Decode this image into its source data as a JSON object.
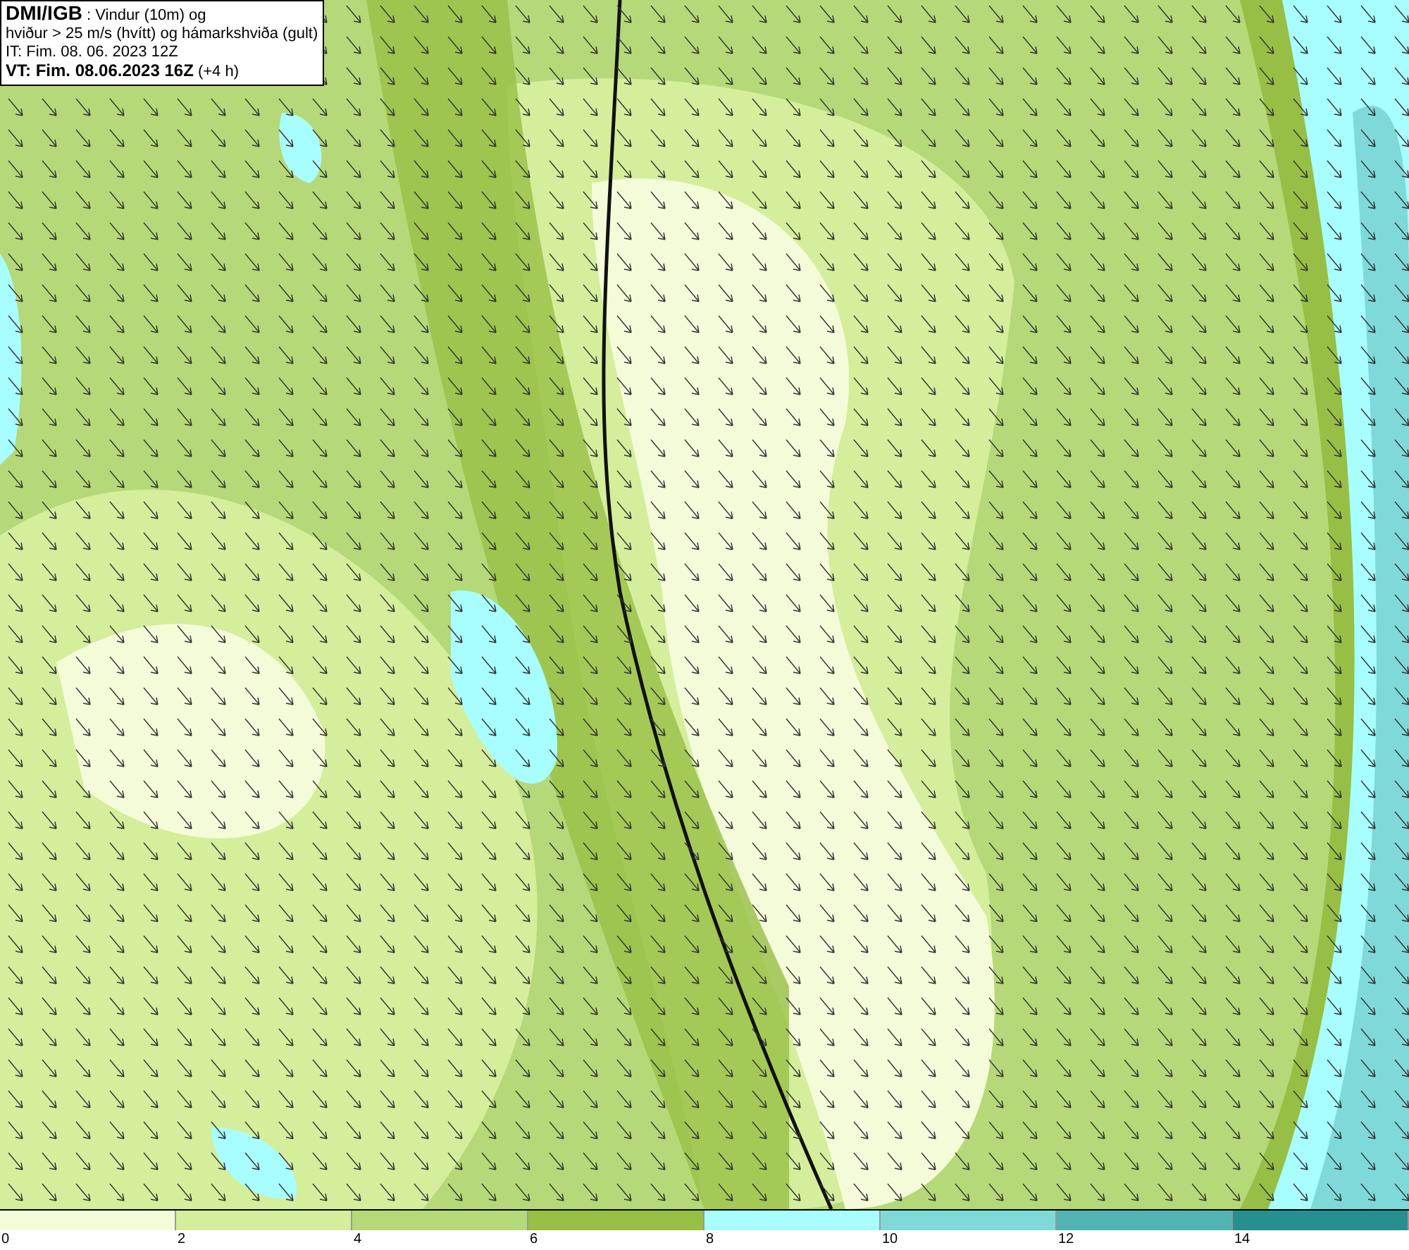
{
  "header": {
    "lines": [
      "**DMI/IGB** : Vindur (10m) og",
      "hviður > 25 m/s (hvítt) og hámarkshviða (gult)",
      "IT: Fim. 08. 06. 2023 12Z",
      "**VT: Fim. 08.06.2023 16Z** (+4 h)"
    ]
  },
  "legend": {
    "bins": [
      {
        "label": "0",
        "color": "#f4fbd9"
      },
      {
        "label": "2",
        "color": "#d4ee9c"
      },
      {
        "label": "4",
        "color": "#b5d978"
      },
      {
        "label": "6",
        "color": "#97bf46"
      },
      {
        "label": "8",
        "color": "#a8fefe"
      },
      {
        "label": "10",
        "color": "#80d9d9"
      },
      {
        "label": "12",
        "color": "#52b3b3"
      },
      {
        "label": "14",
        "color": "#269090"
      }
    ]
  }
}
